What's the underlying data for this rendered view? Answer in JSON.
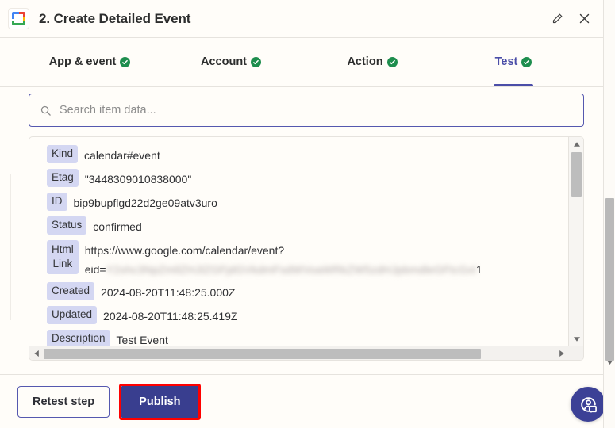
{
  "header": {
    "app_icon": "google-calendar-icon",
    "title": "2. Create Detailed Event",
    "edit_icon": "pencil-icon",
    "close_icon": "close-icon"
  },
  "tabs": [
    {
      "label": "App & event",
      "active": false,
      "status": "complete"
    },
    {
      "label": "Account",
      "active": false,
      "status": "complete"
    },
    {
      "label": "Action",
      "active": false,
      "status": "complete"
    },
    {
      "label": "Test",
      "active": true,
      "status": "complete"
    }
  ],
  "search": {
    "icon": "search-icon",
    "value": "",
    "placeholder": "Search item data..."
  },
  "item_data": {
    "rows": [
      {
        "label": "Kind",
        "value": "calendar#event"
      },
      {
        "label": "Etag",
        "value": "\"3448309010838000\""
      },
      {
        "label": "ID",
        "value": "bip9bupflgd22d2ge09atv3uro"
      },
      {
        "label": "Status",
        "value": "confirmed"
      },
      {
        "label": "Html Link",
        "value_line1": "https://www.google.com/calendar/event?",
        "value_line2_prefix": "eid=",
        "value_line2_redacted": "Y2xhc3NpZmllZHJlZGFjdGVkdmFsdWVoaWRkZW5zdHJpbmdleGFtcGxl",
        "value_line2_suffix": "1"
      },
      {
        "label": "Created",
        "value": "2024-08-20T11:48:25.000Z"
      },
      {
        "label": "Updated",
        "value": "2024-08-20T11:48:25.419Z"
      },
      {
        "label": "Description",
        "value": "Test Event"
      }
    ]
  },
  "scrollbars": {
    "vertical_up_icon": "triangle-up-icon",
    "vertical_down_icon": "triangle-down-icon",
    "horizontal_left_icon": "triangle-left-icon",
    "horizontal_right_icon": "triangle-right-icon"
  },
  "footer": {
    "retest_label": "Retest step",
    "publish_label": "Publish",
    "publish_highlight_color": "#ff0000",
    "publish_color": "#393e8f"
  },
  "help_fab": {
    "icon": "support-chat-icon"
  },
  "colors": {
    "accent": "#4b4ea8",
    "chip_bg": "#d4d7f2",
    "check_green": "#1e8e4e",
    "background": "#fffdf9"
  }
}
